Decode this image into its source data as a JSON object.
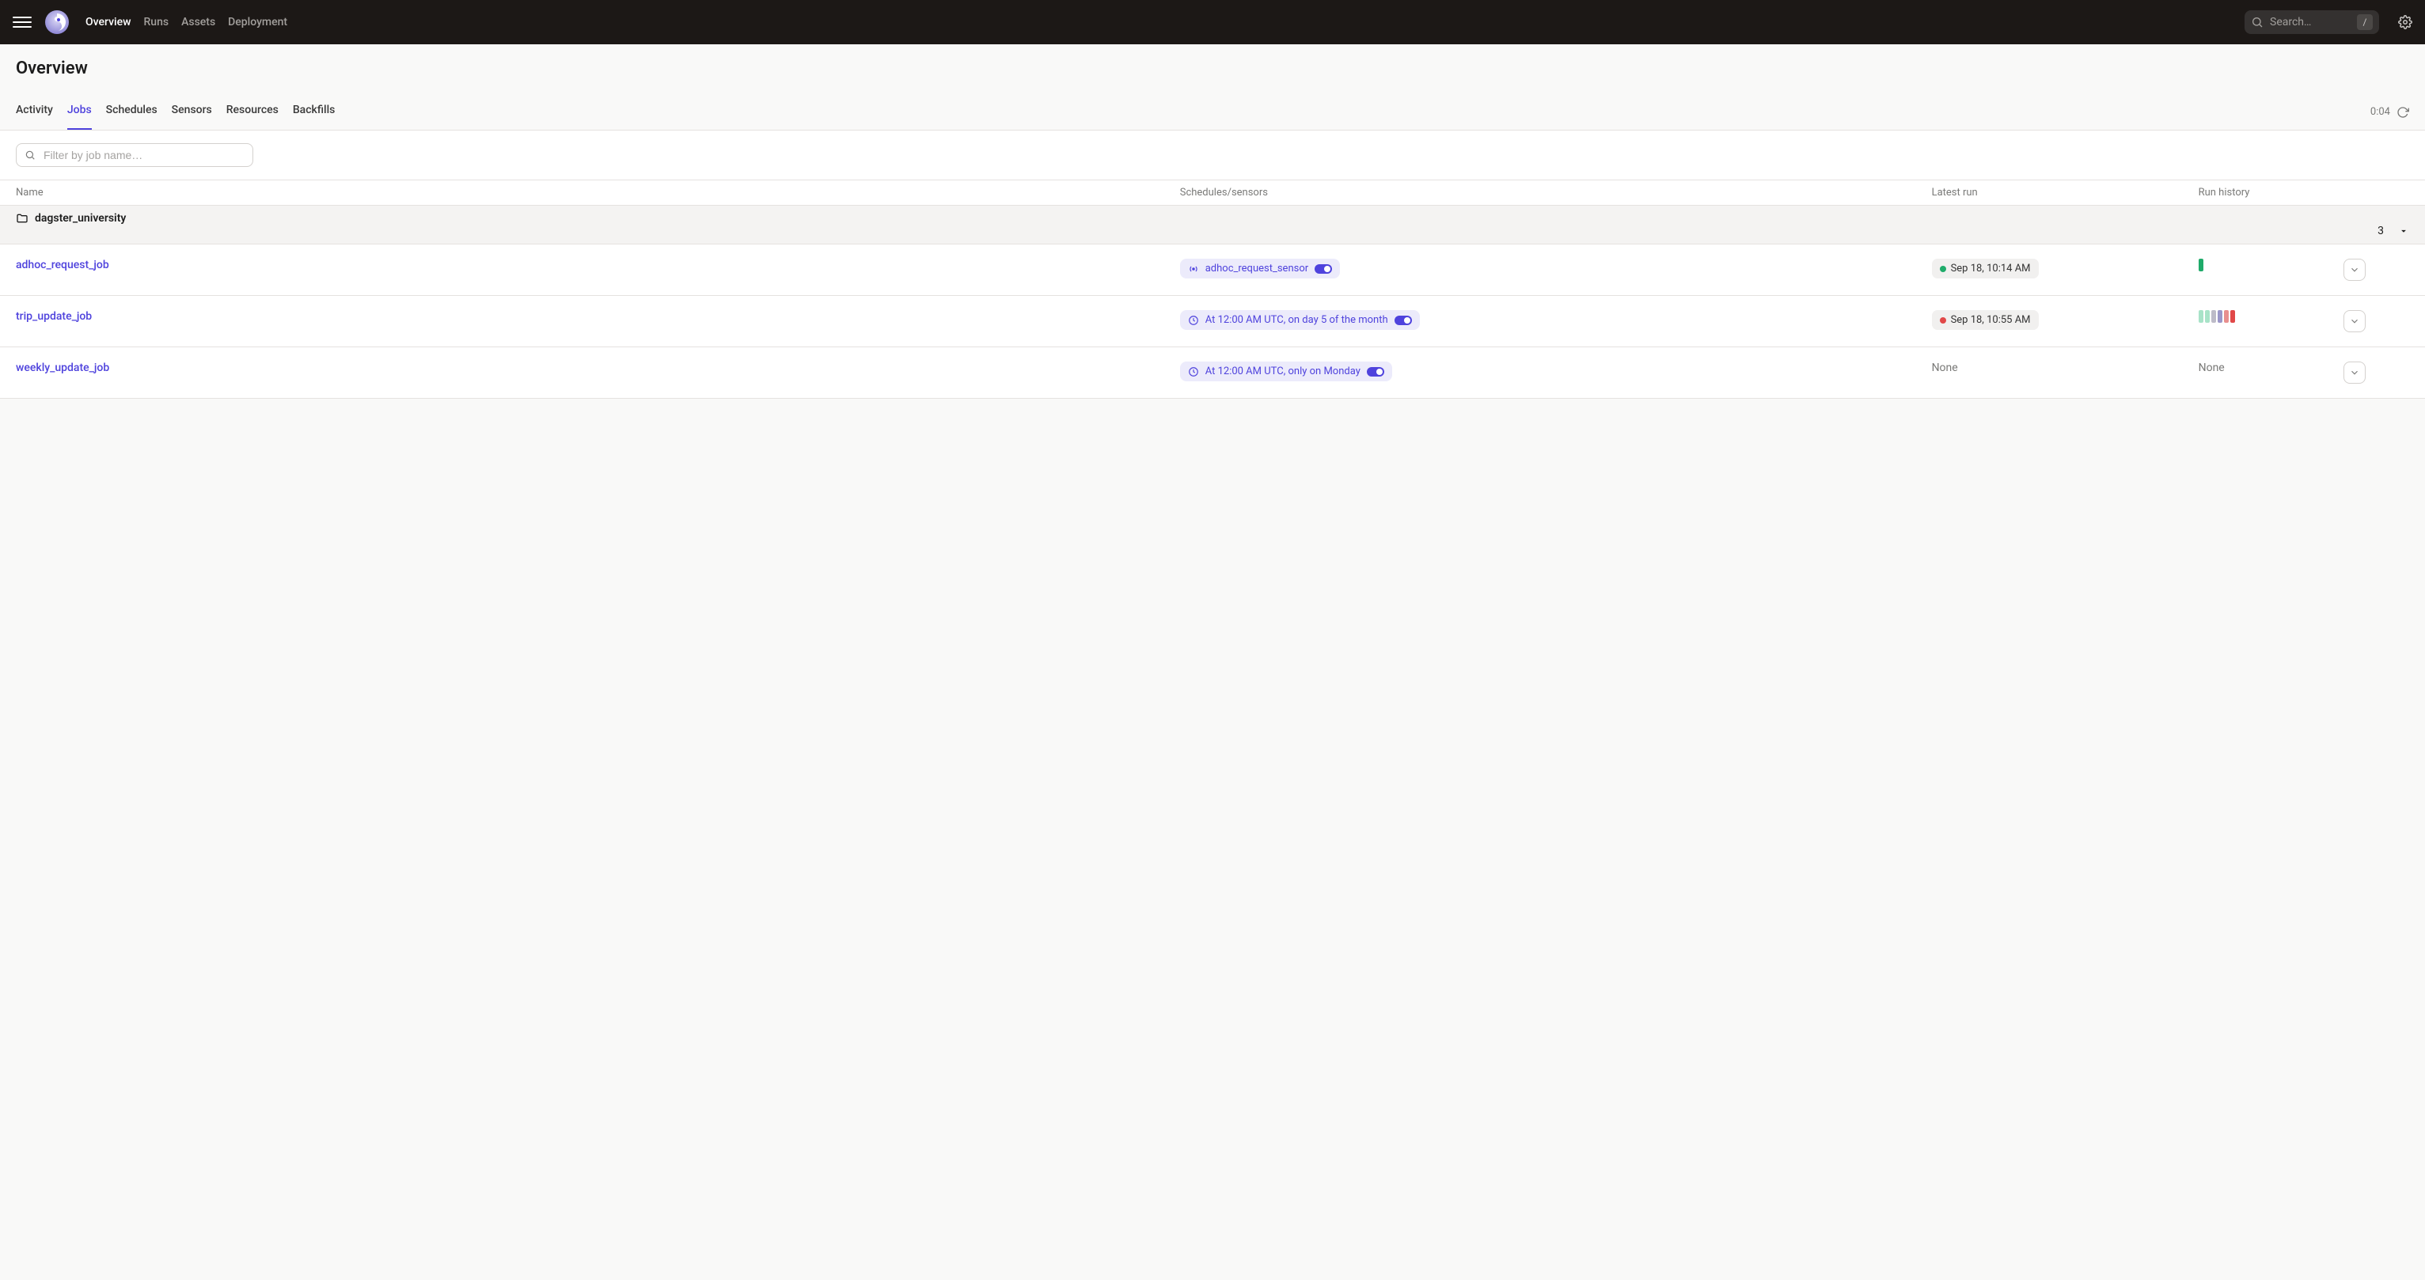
{
  "nav": {
    "links": [
      "Overview",
      "Runs",
      "Assets",
      "Deployment"
    ],
    "active": 0,
    "search_placeholder": "Search…",
    "search_key": "/"
  },
  "page": {
    "title": "Overview"
  },
  "tabs": {
    "items": [
      "Activity",
      "Jobs",
      "Schedules",
      "Sensors",
      "Resources",
      "Backfills"
    ],
    "active": 1,
    "refresh": "0:04"
  },
  "filter": {
    "placeholder": "Filter by job name…"
  },
  "table": {
    "headers": {
      "name": "Name",
      "schedules": "Schedules/sensors",
      "latest": "Latest run",
      "history": "Run history"
    },
    "group": {
      "name": "dagster_university",
      "count": "3"
    },
    "rows": [
      {
        "name": "adhoc_request_job",
        "schedule_type": "sensor",
        "schedule_text": "adhoc_request_sensor",
        "toggle": true,
        "latest_status": "success",
        "latest_text": "Sep 18, 10:14 AM",
        "history": [
          "green"
        ]
      },
      {
        "name": "trip_update_job",
        "schedule_type": "schedule",
        "schedule_text": "At 12:00 AM UTC, on day 5 of the month",
        "toggle": true,
        "latest_status": "fail",
        "latest_text": "Sep 18, 10:55 AM",
        "history": [
          "green-light",
          "green-light",
          "gray",
          "purple",
          "red",
          "red-dark"
        ]
      },
      {
        "name": "weekly_update_job",
        "schedule_type": "schedule",
        "schedule_text": "At 12:00 AM UTC, only on Monday",
        "toggle": true,
        "latest_status": "none",
        "latest_text": "None",
        "history_text": "None"
      }
    ]
  }
}
